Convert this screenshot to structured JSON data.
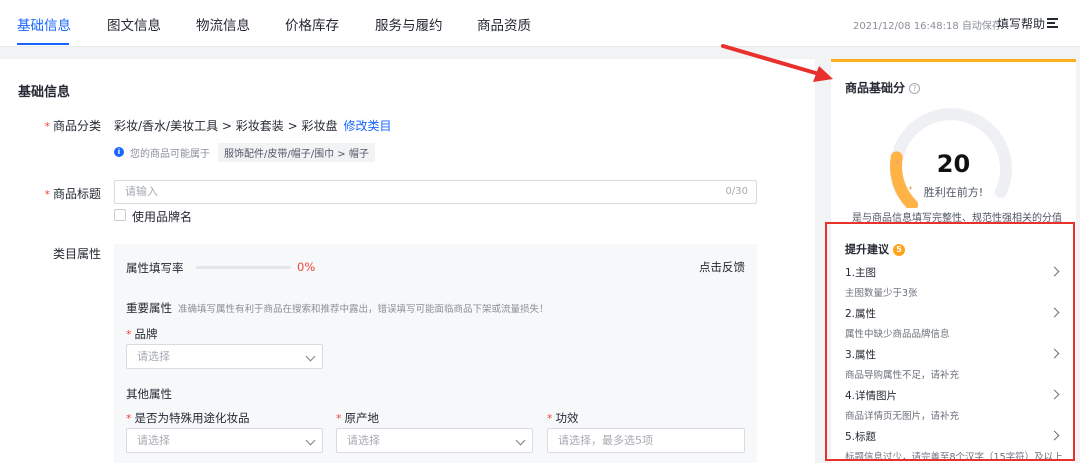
{
  "tabs": [
    {
      "label": "基础信息",
      "active": true
    },
    {
      "label": "图文信息"
    },
    {
      "label": "物流信息"
    },
    {
      "label": "价格库存"
    },
    {
      "label": "服务与履约"
    },
    {
      "label": "商品资质"
    }
  ],
  "header": {
    "autosave": "2021/12/08 16:48:18 自动保存",
    "help_label": "填写帮助"
  },
  "main": {
    "section_title": "基础信息",
    "category": {
      "label": "商品分类",
      "path": "彩妆/香水/美妆工具 > 彩妆套装 > 彩妆盘",
      "edit_link": "修改类目",
      "hint_text": "您的商品可能属于",
      "hint_chip": "服饰配件/皮带/帽子/围巾 > 帽子"
    },
    "title_field": {
      "label": "商品标题",
      "placeholder": "请输入",
      "counter": "0/30",
      "brand_checkbox_label": "使用品牌名"
    },
    "attributes": {
      "label": "类目属性",
      "fill_rate_label": "属性填写率",
      "fill_rate_pct": "0%",
      "fill_rate_value": 0,
      "feedback_label": "点击反馈",
      "important_title": "重要属性",
      "important_desc": "准确填写属性有利于商品在搜索和推荐中露出，错误填写可能面临商品下架或流量损失！",
      "brand_label": "品牌",
      "brand_placeholder": "请选择",
      "other_title": "其他属性",
      "special_use_label": "是否为特殊用途化妆品",
      "special_use_placeholder": "请选择",
      "origin_label": "原产地",
      "origin_placeholder": "请选择",
      "efficacy_label": "功效",
      "efficacy_placeholder": "请选择，最多选5项"
    }
  },
  "side": {
    "title": "商品基础分",
    "score": "20",
    "score_value": 20,
    "score_sub": "胜利在前方!",
    "score_desc": "是与商品信息填写完整性、规范性强相关的分值",
    "suggestions_title": "提升建议",
    "suggestions_count": "5",
    "suggestions": [
      {
        "name": "1.主图",
        "desc": "主图数量少于3张"
      },
      {
        "name": "2.属性",
        "desc": "属性中缺少商品品牌信息"
      },
      {
        "name": "3.属性",
        "desc": "商品导购属性不足，请补充"
      },
      {
        "name": "4.详情图片",
        "desc": "商品详情页无图片，请补充"
      },
      {
        "name": "5.标题",
        "desc": "标题信息过少，请完善至8个汉字（15字符）及以上"
      }
    ]
  },
  "colors": {
    "accent": "#1966ff",
    "required": "#f0443c",
    "score_orange": "#ffb020",
    "annotation_red": "#e8302c"
  }
}
